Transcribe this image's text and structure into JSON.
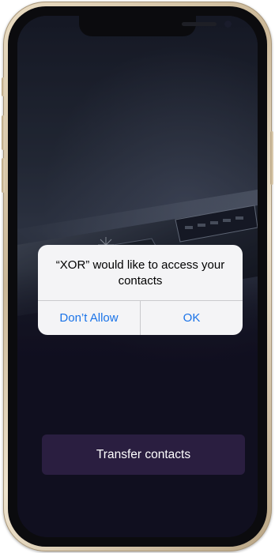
{
  "alert": {
    "message": "“XOR” would like to access your contacts",
    "deny_label": "Don’t Allow",
    "ok_label": "OK"
  },
  "main": {
    "transfer_label": "Transfer contacts"
  },
  "colors": {
    "accent": "#1a73e8",
    "primary_button": "#2a1e40",
    "screen_bg": "#16142a"
  }
}
